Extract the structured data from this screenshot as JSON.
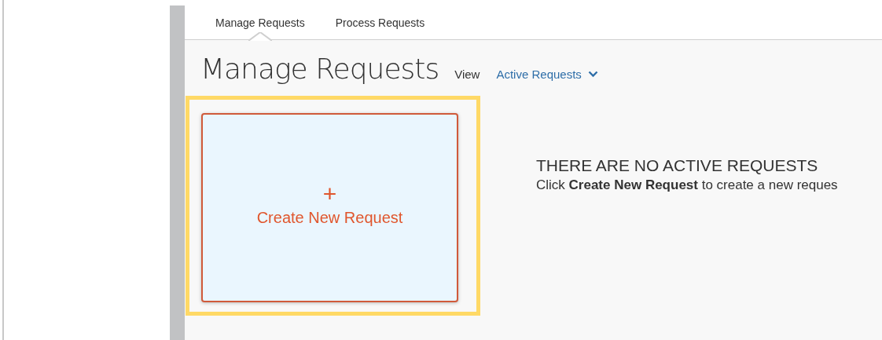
{
  "tabs": [
    {
      "label": "Manage Requests",
      "selected": true
    },
    {
      "label": "Process Requests",
      "selected": false
    }
  ],
  "header": {
    "title": "Manage Requests",
    "view_label": "View",
    "view_value": "Active Requests"
  },
  "create_card": {
    "icon": "+",
    "label": "Create New Request",
    "highlighted": true
  },
  "empty_state": {
    "heading": "THERE ARE NO ACTIVE REQUESTS",
    "message": "Click **Create New Request** to create a new reques"
  }
}
